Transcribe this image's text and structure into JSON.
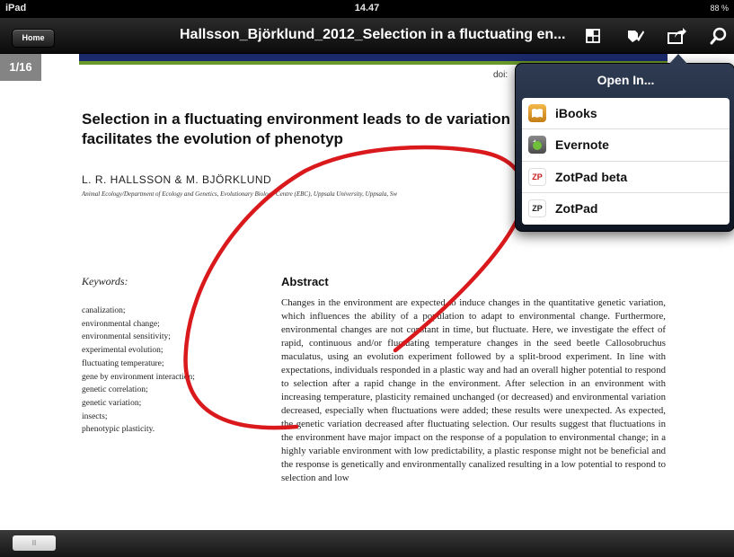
{
  "status_bar": {
    "device": "iPad",
    "time": "14.47",
    "battery": "88 %"
  },
  "nav": {
    "home_label": "Home",
    "title": "Hallsson_Björklund_2012_Selection in a fluctuating en...",
    "icons": [
      "grid-icon",
      "annotate-icon",
      "share-icon",
      "search-icon"
    ]
  },
  "document": {
    "page_counter": "1/16",
    "doi_label": "doi:",
    "title": "Selection in a fluctuating environment leads to de variation and facilitates the evolution of phenotyp",
    "authors": "L. R. HALLSSON & M. BJÖRKLUND",
    "affiliation": "Animal Ecology/Department of Ecology and Genetics, Evolutionary Biology Centre (EBC), Uppsala University, Uppsala, Sw",
    "keywords_title": "Keywords:",
    "keywords": [
      "canalization;",
      "environmental change;",
      "environmental sensitivity;",
      "experimental evolution;",
      "fluctuating temperature;",
      "gene by environment interaction;",
      "genetic correlation;",
      "genetic variation;",
      "insects;",
      "phenotypic plasticity."
    ],
    "abstract_title": "Abstract",
    "abstract_text": "Changes in the environment are expected to induce changes in the quantitative genetic variation, which influences the ability of a population to adapt to environmental change. Furthermore, environmental changes are not constant in time, but fluctuate. Here, we investigate the effect of rapid, continuous and/or fluctuating temperature changes in the seed beetle Callosobruchus maculatus, using an evolution experiment followed by a split-brood experiment. In line with expectations, individuals responded in a plastic way and had an overall higher potential to respond to selection after a rapid change in the environment. After selection in an environment with increasing temperature, plasticity remained unchanged (or decreased) and environmental variation decreased, especially when fluctuations were added; these results were unexpected. As expected, the genetic variation decreased after fluctuating selection. Our results suggest that fluctuations in the environment have major impact on the response of a population to environmental change; in a highly variable environment with low predictability, a plastic response might not be beneficial and the response is genetically and environmentally canalized resulting in a low potential to respond to selection and low"
  },
  "popover": {
    "title": "Open In...",
    "items": [
      {
        "label": "iBooks",
        "icon": "ibooks-icon"
      },
      {
        "label": "Evernote",
        "icon": "evernote-icon"
      },
      {
        "label": "ZotPad beta",
        "icon": "zotpad-beta-icon",
        "badge": "ZP"
      },
      {
        "label": "ZotPad",
        "icon": "zotpad-icon",
        "badge": "ZP"
      }
    ]
  },
  "bottom": {
    "thumb_label": "II"
  },
  "colors": {
    "ink": "#d9191c",
    "journal_band": "#1b2a6b",
    "journal_accent": "#6a9a2a",
    "popover": "#1c2637"
  }
}
